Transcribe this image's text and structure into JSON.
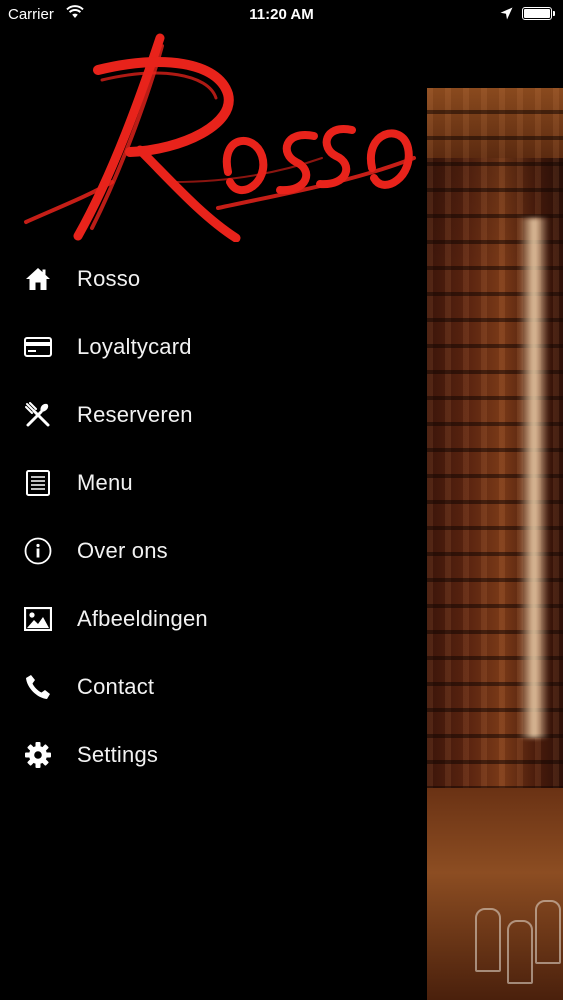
{
  "status_bar": {
    "carrier": "Carrier",
    "time": "11:20 AM",
    "icons": [
      "wifi-icon",
      "location-arrow-icon",
      "battery-icon"
    ]
  },
  "drawer": {
    "logo_text": "Rosso",
    "logo_color": "#e8231b",
    "items": [
      {
        "label": "Rosso",
        "icon": "home-icon"
      },
      {
        "label": "Loyaltycard",
        "icon": "credit-card-icon"
      },
      {
        "label": "Reserveren",
        "icon": "utensils-icon"
      },
      {
        "label": "Menu",
        "icon": "menu-list-icon"
      },
      {
        "label": "Over ons",
        "icon": "info-icon"
      },
      {
        "label": "Afbeeldingen",
        "icon": "image-icon"
      },
      {
        "label": "Contact",
        "icon": "phone-icon"
      },
      {
        "label": "Settings",
        "icon": "gear-icon"
      }
    ]
  },
  "colors": {
    "background": "#000000",
    "text": "#f2f2f2",
    "accent": "#e8231b"
  }
}
